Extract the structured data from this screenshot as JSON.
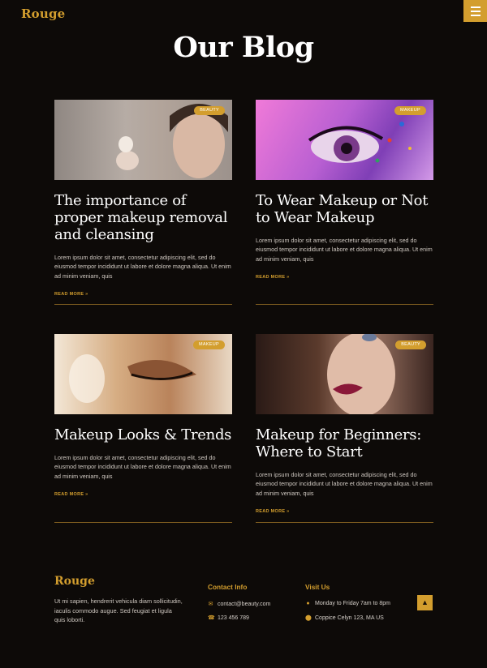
{
  "header": {
    "logo": "Rouge",
    "menu_icon": "hamburger-icon"
  },
  "page": {
    "title": "Our Blog"
  },
  "posts": [
    {
      "badge": "BEAUTY",
      "title": "The importance of proper makeup removal and cleansing",
      "excerpt": "Lorem ipsum dolor sit amet, consectetur adipiscing elit, sed do eiusmod tempor incididunt ut labore et dolore magna aliqua. Ut enim ad minim veniam, quis",
      "read_more": "READ MORE »"
    },
    {
      "badge": "MAKEUP",
      "title": "To Wear Makeup or Not to Wear Makeup",
      "excerpt": "Lorem ipsum dolor sit amet, consectetur adipiscing elit, sed do eiusmod tempor incididunt ut labore et dolore magna aliqua. Ut enim ad minim veniam, quis",
      "read_more": "READ MORE »"
    },
    {
      "badge": "MAKEUP",
      "title": "Makeup Looks & Trends",
      "excerpt": "Lorem ipsum dolor sit amet, consectetur adipiscing elit, sed do eiusmod tempor incididunt ut labore et dolore magna aliqua. Ut enim ad minim veniam, quis",
      "read_more": "READ MORE »"
    },
    {
      "badge": "BEAUTY",
      "title": "Makeup for Beginners: Where to Start",
      "excerpt": "Lorem ipsum dolor sit amet, consectetur adipiscing elit, sed do eiusmod tempor incididunt ut labore et dolore magna aliqua. Ut enim ad minim veniam, quis",
      "read_more": "READ MORE »"
    }
  ],
  "footer": {
    "logo": "Rouge",
    "about": "Ut mi sapien, hendrerit vehicula diam sollicitudin, iaculis commodo augue. Sed feugiat et ligula quis loborti.",
    "contact_heading": "Contact Info",
    "email": "contact@beauty.com",
    "phone": "123 456 789",
    "visit_heading": "Visit Us",
    "hours": "Monday to Friday 7am to 8pm",
    "address": "Coppice Celyn 123, MA US",
    "to_top_icon": "chevron-up-icon"
  },
  "colors": {
    "background": "#0d0a08",
    "accent": "#d39e2e",
    "text": "#ffffff"
  }
}
